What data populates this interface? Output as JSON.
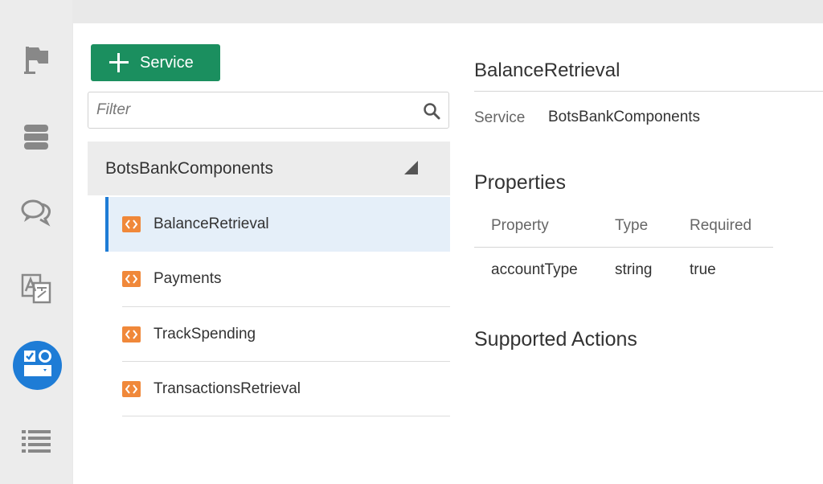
{
  "rail": {
    "items": [
      {
        "name": "flag-icon"
      },
      {
        "name": "database-icon"
      },
      {
        "name": "chat-icon"
      },
      {
        "name": "translate-icon"
      },
      {
        "name": "components-icon",
        "active": true
      },
      {
        "name": "list-icon"
      }
    ],
    "active_color": "#1e7cd6"
  },
  "toolbar": {
    "add_label": "Service",
    "add_color": "#1b8f5f"
  },
  "filter": {
    "placeholder": "Filter",
    "value": ""
  },
  "group": {
    "name": "BotsBankComponents",
    "expanded": true
  },
  "services": [
    {
      "label": "BalanceRetrieval",
      "selected": true
    },
    {
      "label": "Payments",
      "selected": false
    },
    {
      "label": "TrackSpending",
      "selected": false
    },
    {
      "label": "TransactionsRetrieval",
      "selected": false
    }
  ],
  "detail": {
    "title": "BalanceRetrieval",
    "service_label": "Service",
    "service_value": "BotsBankComponents",
    "properties_heading": "Properties",
    "columns": [
      "Property",
      "Type",
      "Required"
    ],
    "rows": [
      [
        "accountType",
        "string",
        "true"
      ]
    ],
    "actions_heading": "Supported Actions"
  },
  "colors": {
    "item_icon": "#f0883a",
    "selected_bg": "#e5eff9"
  }
}
